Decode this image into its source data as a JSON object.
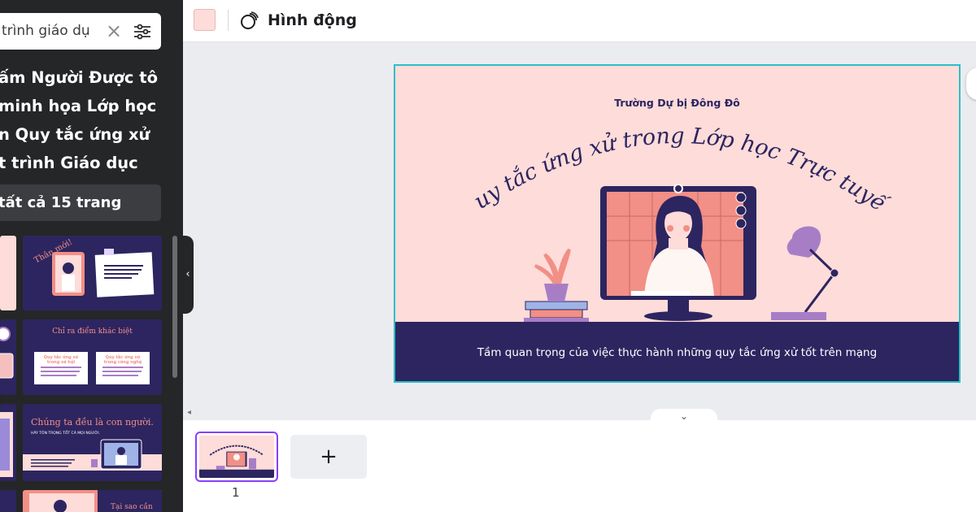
{
  "sidebar": {
    "search_value": "trình giáo dụ",
    "template_title_lines": [
      "ấm Người Được tô",
      "minh họa Lớp học",
      "n Quy tắc ứng xử",
      "t trình Giáo dục"
    ],
    "use_all_label": "tất cả 15 trang",
    "thumbs": [
      {
        "heading": "Thân mới!",
        "body": "Còn có bạn để tham gia buổi thảo luận quan trọng về những quy tắc trực tuyến trong thế hệ chuyển thay mới."
      },
      {
        "heading": "Chỉ ra điểm khác biệt",
        "card1": "Quy tắc ứng xử trong xã hội",
        "card2": "Quy tắc ứng xử trong công nghệ"
      },
      {
        "heading": "Chúng ta đều là con người.",
        "sub": "HÃY TÔN TRỌNG TỐT CÁ MỌI NGƯỜI."
      },
      {
        "heading": "Tại sao cần"
      }
    ]
  },
  "topbar": {
    "color_swatch": "#fddcd9",
    "animate_label": "Hình động"
  },
  "slide": {
    "school": "Trường Dự bị Đông Đô",
    "title": "Quy tắc ứng xử trong Lớp học Trực tuyến",
    "subtitle": "Tầm quan trọng của việc thực hành những quy tắc ứng xử tốt trên mạng",
    "colors": {
      "background": "#fddcd9",
      "navy": "#2d2560",
      "accent": "#f28f86",
      "purple": "#a77ec6"
    }
  },
  "pages": {
    "page_number": "1",
    "add_label": "+"
  }
}
